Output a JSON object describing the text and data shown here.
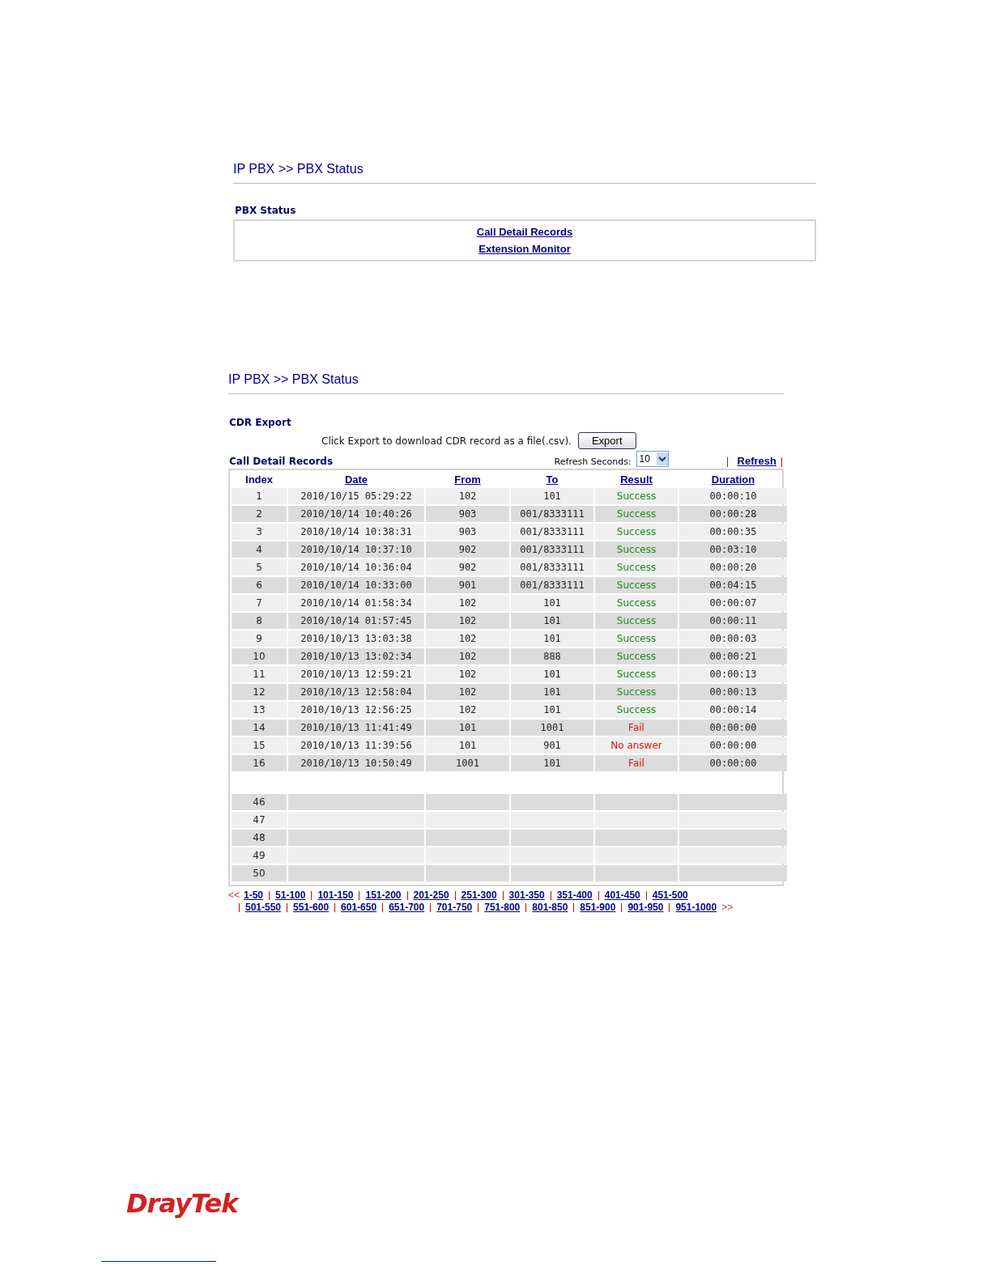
{
  "panel_1": {
    "title": "IP PBX >> PBX Status",
    "section": "PBX Status",
    "links": [
      "Call Detail Records",
      "Extension Monitor"
    ]
  },
  "panel_2": {
    "title": "IP PBX >> PBX Status",
    "export_section": "CDR Export",
    "export_hint": "Click Export to download CDR record as a file(.csv).",
    "export_button": "Export",
    "records_title": "Call Detail Records",
    "refresh_label": "Refresh Seconds:",
    "refresh_value": "10",
    "refresh_link": "Refresh",
    "columns": [
      {
        "label": "Index",
        "link": false
      },
      {
        "label": "Date",
        "link": true
      },
      {
        "label": "From",
        "link": true
      },
      {
        "label": "To",
        "link": true
      },
      {
        "label": "Result",
        "link": true
      },
      {
        "label": "Duration",
        "link": true
      }
    ],
    "rows": [
      {
        "index": "1",
        "date": "2010/10/15 05:29:22",
        "from": "102",
        "to": "101",
        "result": "Success",
        "color": "#1a8a1a",
        "duration": "00:00:10"
      },
      {
        "index": "2",
        "date": "2010/10/14 10:40:26",
        "from": "903",
        "to": "001/8333111",
        "result": "Success",
        "color": "#1a8a1a",
        "duration": "00:00:28"
      },
      {
        "index": "3",
        "date": "2010/10/14 10:38:31",
        "from": "903",
        "to": "001/8333111",
        "result": "Success",
        "color": "#1a8a1a",
        "duration": "00:00:35"
      },
      {
        "index": "4",
        "date": "2010/10/14 10:37:10",
        "from": "902",
        "to": "001/8333111",
        "result": "Success",
        "color": "#1a8a1a",
        "duration": "00:03:10"
      },
      {
        "index": "5",
        "date": "2010/10/14 10:36:04",
        "from": "902",
        "to": "001/8333111",
        "result": "Success",
        "color": "#1a8a1a",
        "duration": "00:00:20"
      },
      {
        "index": "6",
        "date": "2010/10/14 10:33:00",
        "from": "901",
        "to": "001/8333111",
        "result": "Success",
        "color": "#1a8a1a",
        "duration": "00:04:15"
      },
      {
        "index": "7",
        "date": "2010/10/14 01:58:34",
        "from": "102",
        "to": "101",
        "result": "Success",
        "color": "#1a8a1a",
        "duration": "00:00:07"
      },
      {
        "index": "8",
        "date": "2010/10/14 01:57:45",
        "from": "102",
        "to": "101",
        "result": "Success",
        "color": "#1a8a1a",
        "duration": "00:00:11"
      },
      {
        "index": "9",
        "date": "2010/10/13 13:03:38",
        "from": "102",
        "to": "101",
        "result": "Success",
        "color": "#1a8a1a",
        "duration": "00:00:03"
      },
      {
        "index": "10",
        "date": "2010/10/13 13:02:34",
        "from": "102",
        "to": "888",
        "result": "Success",
        "color": "#1a8a1a",
        "duration": "00:00:21"
      },
      {
        "index": "11",
        "date": "2010/10/13 12:59:21",
        "from": "102",
        "to": "101",
        "result": "Success",
        "color": "#1a8a1a",
        "duration": "00:00:13"
      },
      {
        "index": "12",
        "date": "2010/10/13 12:58:04",
        "from": "102",
        "to": "101",
        "result": "Success",
        "color": "#1a8a1a",
        "duration": "00:00:13"
      },
      {
        "index": "13",
        "date": "2010/10/13 12:56:25",
        "from": "102",
        "to": "101",
        "result": "Success",
        "color": "#1a8a1a",
        "duration": "00:00:14"
      },
      {
        "index": "14",
        "date": "2010/10/13 11:41:49",
        "from": "101",
        "to": "1001",
        "result": "Fail",
        "color": "#dd1111",
        "duration": "00:00:00"
      },
      {
        "index": "15",
        "date": "2010/10/13 11:39:56",
        "from": "101",
        "to": "901",
        "result": "No answer",
        "color": "#dd1111",
        "duration": "00:00:00"
      },
      {
        "index": "16",
        "date": "2010/10/13 10:50:49",
        "from": "1001",
        "to": "101",
        "result": "Fail",
        "color": "#dd1111",
        "duration": "00:00:00"
      }
    ],
    "empty_rows": [
      "46",
      "47",
      "48",
      "49",
      "50"
    ],
    "pager_prev": "<<",
    "pager_next": ">>",
    "pages_line_1": [
      "1-50",
      "51-100",
      "101-150",
      "151-200",
      "201-250",
      "251-300",
      "301-350",
      "351-400",
      "401-450",
      "451-500"
    ],
    "pages_line_2": [
      "501-550",
      "551-600",
      "601-650",
      "651-700",
      "701-750",
      "751-800",
      "801-850",
      "851-900",
      "901-950",
      "951-1000"
    ]
  },
  "footer": {
    "logo": "DrayTek"
  }
}
